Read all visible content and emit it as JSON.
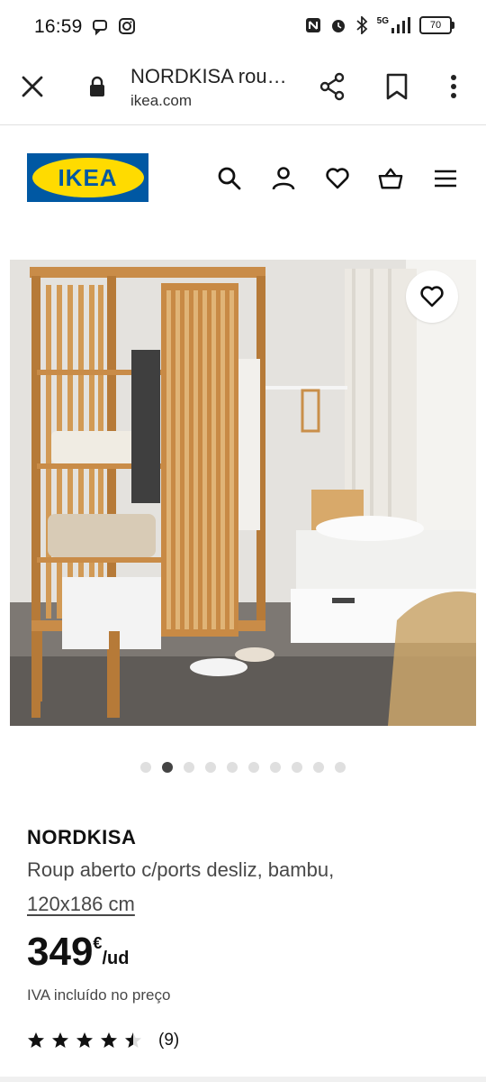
{
  "status_bar": {
    "time": "16:59",
    "network": "5G",
    "battery": "70",
    "icons": [
      "chat-bubble-icon",
      "instagram-icon",
      "nfc-icon",
      "alarm-icon",
      "bluetooth-icon",
      "signal-icon",
      "battery-icon"
    ]
  },
  "browser": {
    "title": "NORDKISA rou…",
    "url": "ikea.com",
    "icons": [
      "close-icon",
      "lock-icon",
      "share-icon",
      "bookmark-icon",
      "more-vert-icon"
    ]
  },
  "header": {
    "logo_text": "IKEA",
    "brand_colors": {
      "blue": "#0058a3",
      "yellow": "#ffdb00"
    },
    "icons": [
      "search-icon",
      "account-icon",
      "heart-icon",
      "basket-icon",
      "menu-icon"
    ]
  },
  "gallery": {
    "total_images": 10,
    "active_index": 1
  },
  "product": {
    "name": "NORDKISA",
    "description": "Roup aberto c/ports desliz, bambu,",
    "size": "120x186 cm",
    "price_integer": "349",
    "price_currency": "€",
    "price_unit": "/ud",
    "vat_note": "IVA incluído no preço",
    "rating_value": 4.5,
    "rating_max": 5,
    "rating_count": "(9)"
  }
}
